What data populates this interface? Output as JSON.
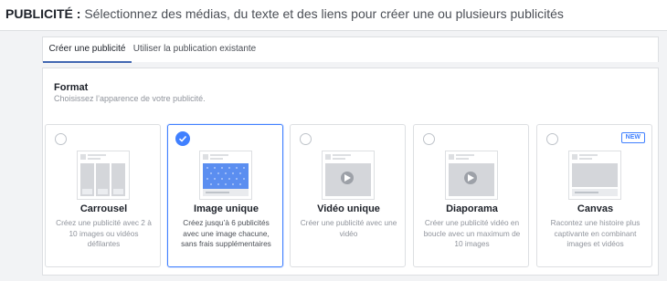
{
  "header": {
    "title": "PUBLICITÉ :",
    "subtitle": "Sélectionnez des médias, du texte et des liens pour créer une ou plusieurs publicités"
  },
  "tabs": [
    {
      "label": "Créer une publicité",
      "active": true
    },
    {
      "label": "Utiliser la publication existante",
      "active": false
    }
  ],
  "format": {
    "title": "Format",
    "subtitle": "Choisissez l’apparence de votre publicité."
  },
  "cards": [
    {
      "title": "Carrousel",
      "description": "Créez une publicité avec 2 à 10 images ou vidéos défilantes",
      "selected": false,
      "icon": "carousel-preview"
    },
    {
      "title": "Image unique",
      "description": "Créez jusqu’à 6 publicités avec une image chacune, sans frais supplémentaires",
      "selected": true,
      "icon": "single-image-preview"
    },
    {
      "title": "Vidéo unique",
      "description": "Créer une publicité avec une vidéo",
      "selected": false,
      "icon": "video-preview"
    },
    {
      "title": "Diaporama",
      "description": "Créer une publicité vidéo en boucle avec un maximum de 10 images",
      "selected": false,
      "icon": "slideshow-preview"
    },
    {
      "title": "Canvas",
      "description": "Racontez une histoire plus captivante en combinant images et vidéos",
      "selected": false,
      "icon": "canvas-preview",
      "badge": "NEW"
    }
  ],
  "colors": {
    "accent": "#4080ff",
    "tab_underline": "#4267b2",
    "image_preview": "#5b8ef0",
    "muted_text": "#90949c"
  }
}
